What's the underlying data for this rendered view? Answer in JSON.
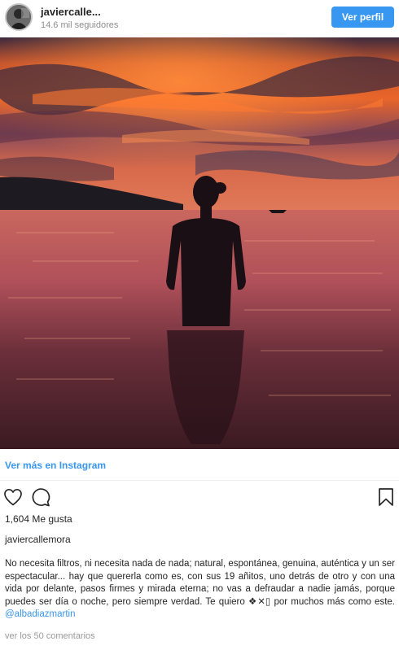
{
  "header": {
    "username": "javiercalle...",
    "followers": "14.6 mil seguidores",
    "view_profile_label": "Ver perfil"
  },
  "photo": {
    "description_icon": "sunset-beach-photo"
  },
  "more_link": "Ver más en Instagram",
  "actions": {
    "like_icon": "heart-icon",
    "comment_icon": "comment-icon",
    "bookmark_icon": "bookmark-icon"
  },
  "likes": "1,604 Me gusta",
  "author": "javiercallemora",
  "caption": {
    "text": "No necesita filtros, ni necesita nada de nada; natural, espontánea, genuina, auténtica y un ser espectacular... hay que quererla como es, con sus 19 añitos, uno detrás de otro y con una vida por delante, pasos firmes y mirada eterna; no vas a defraudar a nadie jamás, porque puedes ser día o noche, pero siempre verdad. Te quiero ❖✕▯ por muchos más como este.",
    "mention": "@albadiazmartin"
  },
  "comments_link": "ver los 50 comentarios",
  "colors": {
    "accent": "#3897f0",
    "text": "#262626",
    "muted": "#8e8e8e"
  }
}
